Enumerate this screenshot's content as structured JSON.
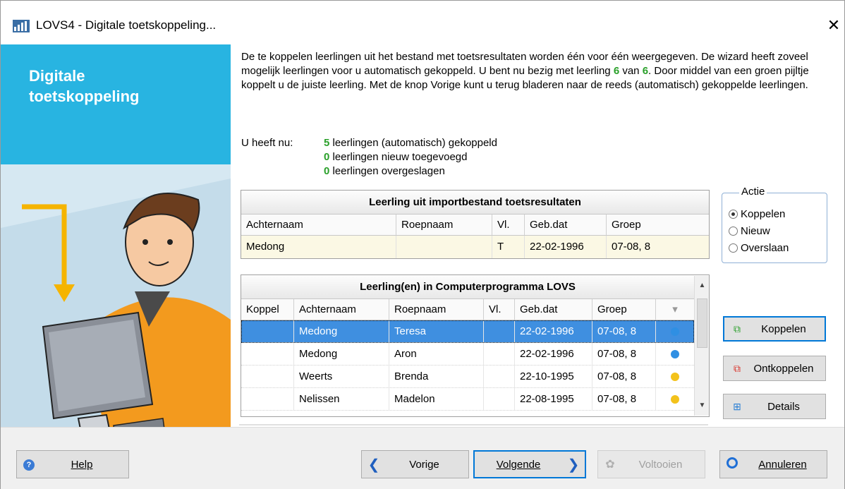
{
  "window": {
    "title": "LOVS4 - Digitale toetskoppeling...",
    "close_label": "✕"
  },
  "sidebar": {
    "title_line1": "Digitale",
    "title_line2": "toetskoppeling"
  },
  "intro": {
    "p1": "De te koppelen leerlingen uit het bestand met toetsresultaten worden één voor één weergegeven. De wizard heeft zoveel mogelijk leerlingen voor u automatisch gekoppeld. U bent nu bezig met leerling ",
    "current": "6",
    "p2": " van ",
    "total": "6",
    "p3": ".   Door middel van een groen pijltje koppelt u de juiste leerling. Met de knop Vorige kunt u terug bladeren naar de reeds (automatisch) gekoppelde leerlingen."
  },
  "status": {
    "label": "U heeft nu:",
    "linked_count": "5",
    "linked_text": " leerlingen (automatisch) gekoppeld",
    "new_count": "0",
    "new_text": " leerlingen nieuw toegevoegd",
    "skipped_count": "0",
    "skipped_text": " leerlingen overgeslagen"
  },
  "import_grid": {
    "header": "Leerling uit importbestand toetsresultaten",
    "columns": [
      "Achternaam",
      "Roepnaam",
      "Vl.",
      "Geb.dat",
      "Groep"
    ],
    "row": [
      "Medong",
      "",
      "T",
      "22-02-1996",
      "07-08, 8"
    ]
  },
  "actie": {
    "legend": "Actie",
    "options": [
      "Koppelen",
      "Nieuw",
      "Overslaan"
    ],
    "selected": "Koppelen"
  },
  "lovs_grid": {
    "header": "Leerling(en) in Computerprogramma LOVS",
    "columns": [
      "Koppel",
      "Achternaam",
      "Roepnaam",
      "Vl.",
      "Geb.dat",
      "Groep"
    ],
    "rows": [
      {
        "koppel": "",
        "achternaam": "Medong",
        "roepnaam": "Teresa",
        "vl": "",
        "gebdat": "22-02-1996",
        "groep": "07-08, 8",
        "status_color": "#2f8fe3"
      },
      {
        "koppel": "",
        "achternaam": "Medong",
        "roepnaam": "Aron",
        "vl": "",
        "gebdat": "22-02-1996",
        "groep": "07-08, 8",
        "status_color": "#2f8fe3"
      },
      {
        "koppel": "",
        "achternaam": "Weerts",
        "roepnaam": "Brenda",
        "vl": "",
        "gebdat": "22-10-1995",
        "groep": "07-08, 8",
        "status_color": "#f3c21b"
      },
      {
        "koppel": "",
        "achternaam": "Nelissen",
        "roepnaam": "Madelon",
        "vl": "",
        "gebdat": "22-08-1995",
        "groep": "07-08, 8",
        "status_color": "#f3c21b"
      }
    ]
  },
  "side_buttons": {
    "koppelen": "Koppelen",
    "ontkoppelen": "Ontkoppelen",
    "details": "Details"
  },
  "footer": {
    "help": "Help",
    "vorige": "Vorige",
    "volgende": "Volgende",
    "voltooien": "Voltooien",
    "annuleren": "Annuleren"
  },
  "colors": {
    "accent": "#28b4e1",
    "selected_row": "#3f8fe0",
    "count_green": "#2aa02a"
  }
}
